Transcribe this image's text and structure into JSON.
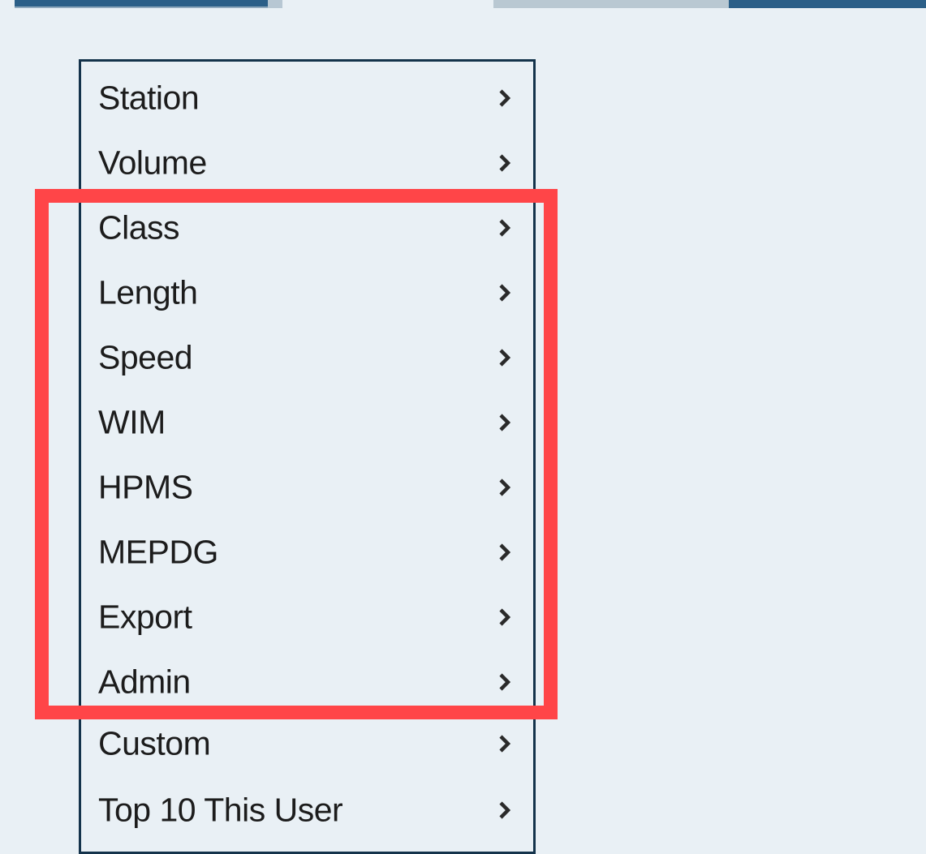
{
  "menu": {
    "items": [
      {
        "label": "Station"
      },
      {
        "label": "Volume"
      },
      {
        "label": "Class"
      },
      {
        "label": "Length"
      },
      {
        "label": "Speed"
      },
      {
        "label": "WIM"
      },
      {
        "label": "HPMS"
      },
      {
        "label": "MEPDG"
      },
      {
        "label": "Export"
      },
      {
        "label": "Admin"
      },
      {
        "label": "Custom"
      },
      {
        "label": "Top 10 This User"
      }
    ],
    "submenu_indicator_icon": "chevron-right-icon"
  },
  "highlight": {
    "color": "#ff4548"
  },
  "colors": {
    "background": "#e9f0f5",
    "menu_border": "#14334b",
    "text": "#1c1c1c",
    "top_bar_accent": "#2b5f88"
  }
}
